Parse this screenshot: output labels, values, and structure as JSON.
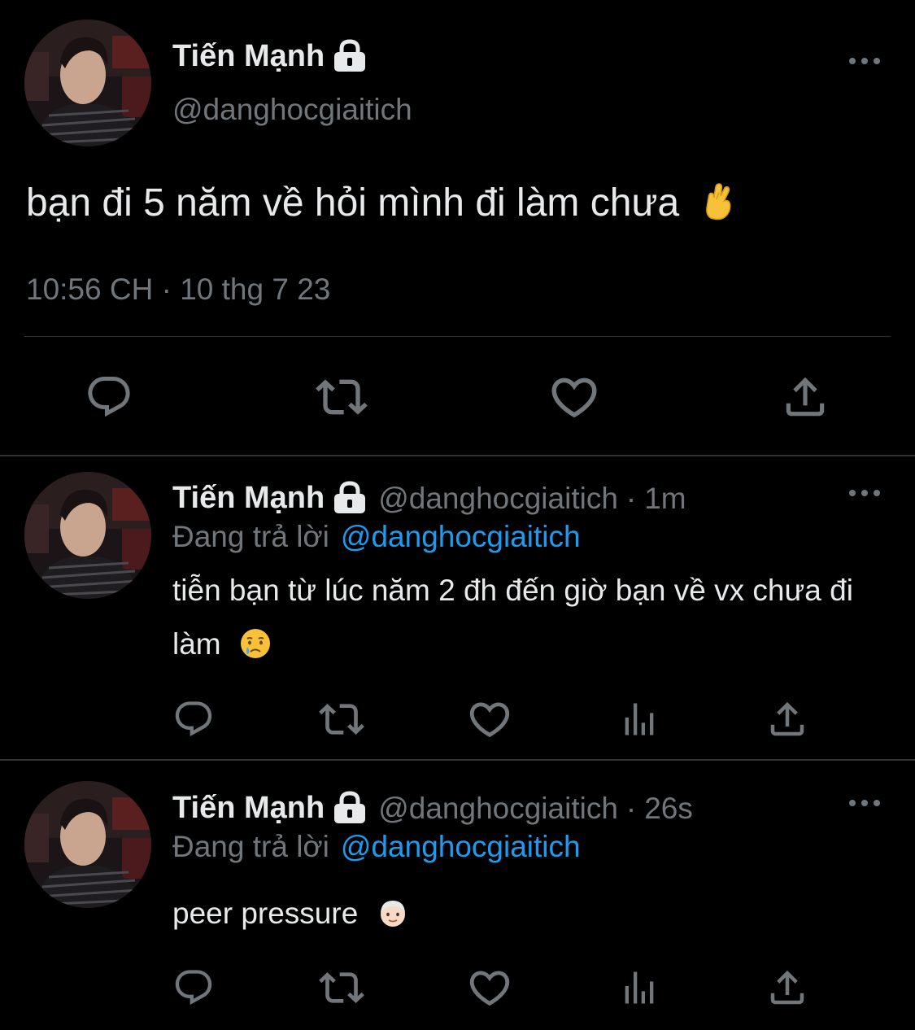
{
  "main_tweet": {
    "author_name": "Tiến Mạnh",
    "handle": "@danghocgiaitich",
    "text": "bạn đi 5 năm về hỏi mình đi làm chưa",
    "emoji": "crossed-fingers",
    "timestamp": "10:56 CH · 10 thg 7 23",
    "actions": [
      "reply-icon",
      "retweet-icon",
      "like-icon",
      "share-icon"
    ]
  },
  "replies": [
    {
      "author_name": "Tiến Mạnh",
      "handle": "@danghocgiaitich",
      "separator": "·",
      "time": "1m",
      "replying_label": "Đang trả lời",
      "replying_to": "@danghocgiaitich",
      "text": "tiễn bạn từ lúc năm 2 đh đến giờ bạn về vx chưa đi làm",
      "emoji": "crying-face",
      "actions": [
        "reply-icon",
        "retweet-icon",
        "like-icon",
        "views-icon",
        "share-icon"
      ]
    },
    {
      "author_name": "Tiến Mạnh",
      "handle": "@danghocgiaitich",
      "separator": "·",
      "time": "26s",
      "replying_label": "Đang trả lời",
      "replying_to": "@danghocgiaitich",
      "text": "peer pressure",
      "emoji": "older-person-light-skin",
      "actions": [
        "reply-icon",
        "retweet-icon",
        "like-icon",
        "views-icon",
        "share-icon"
      ]
    }
  ],
  "colors": {
    "background": "#000000",
    "text": "#e7e9ea",
    "secondary": "#71767b",
    "link": "#1d9bf0",
    "divider": "#2f3336"
  }
}
